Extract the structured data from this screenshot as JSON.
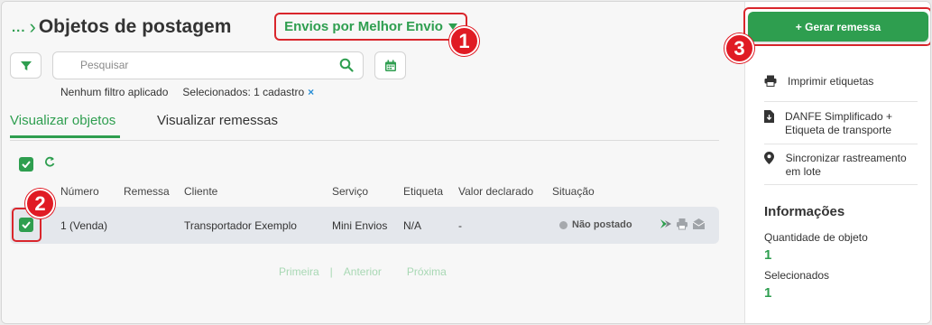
{
  "header": {
    "breadcrumb_dots": "...",
    "title": "Objetos de postagem",
    "provider_label": "Envios por Melhor Envio"
  },
  "toolbar": {
    "search_placeholder": "Pesquisar",
    "filter_status": "Nenhum filtro aplicado",
    "selected_text": "Selecionados: 1 cadastro",
    "clear_icon": "×"
  },
  "tabs": [
    {
      "label": "Visualizar objetos",
      "active": true
    },
    {
      "label": "Visualizar remessas",
      "active": false
    }
  ],
  "table": {
    "refresh_icon": "C",
    "columns": [
      "Número",
      "Remessa",
      "Cliente",
      "Serviço",
      "Etiqueta",
      "Valor declarado",
      "Situação"
    ],
    "rows": [
      {
        "checked": true,
        "numero": "1 (Venda)",
        "remessa": "",
        "cliente": "Transportador Exemplo",
        "servico": "Mini Envios",
        "etiqueta": "N/A",
        "valor": "-",
        "situacao": "Não postado"
      }
    ]
  },
  "pagination": {
    "first": "Primeira",
    "sep": "|",
    "prev": "Anterior",
    "next": "Próxima"
  },
  "sidebar": {
    "generate_button": "+ Gerar remessa",
    "menu": [
      {
        "label": "Imprimir etiquetas",
        "icon": "printer-icon"
      },
      {
        "label": "DANFE Simplificado + Etiqueta de transporte",
        "icon": "document-download-icon"
      },
      {
        "label": "Sincronizar rastreamento em lote",
        "icon": "location-pin-icon"
      }
    ],
    "info_title": "Informações",
    "info": [
      {
        "label": "Quantidade de objeto",
        "value": "1"
      },
      {
        "label": "Selecionados",
        "value": "1"
      }
    ]
  },
  "callouts": [
    "1",
    "2",
    "3"
  ],
  "colors": {
    "brand_green": "#2e9e4f",
    "callout_red": "#e01b24"
  }
}
